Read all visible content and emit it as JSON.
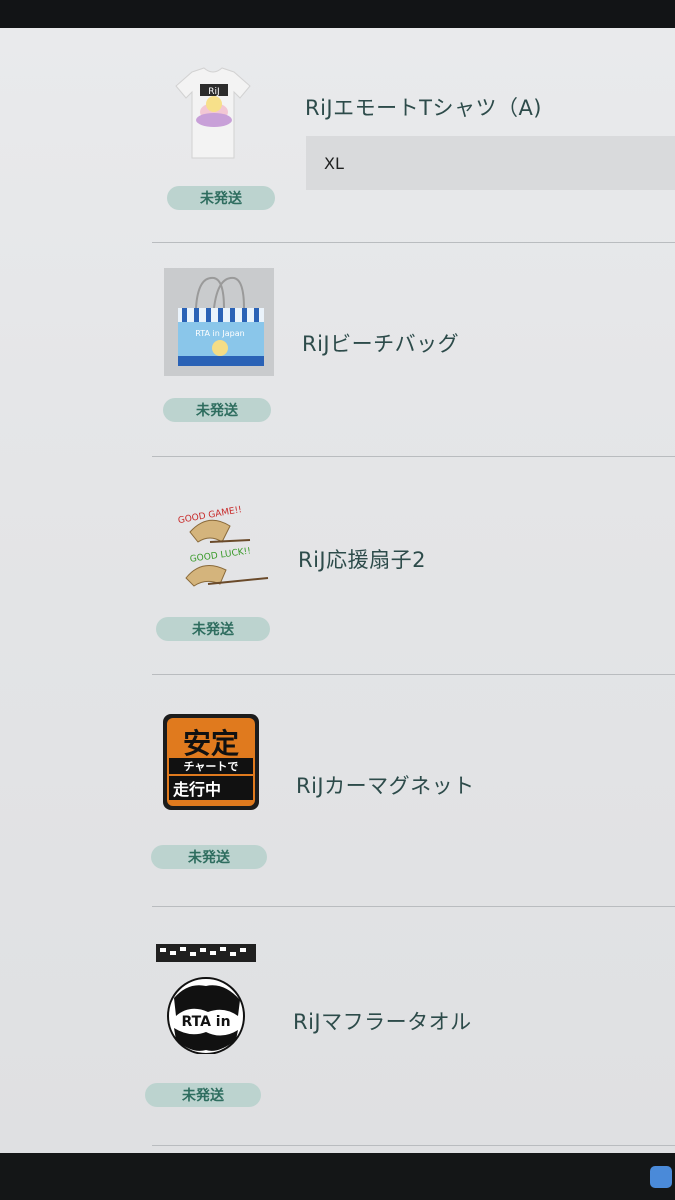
{
  "status_label": "未発送",
  "items": [
    {
      "name": "RiJエモートTシャツ（A)",
      "option": "XL",
      "status": "未発送",
      "thumb_text": "RiJ"
    },
    {
      "name": "RiJビーチバッグ",
      "status": "未発送",
      "thumb_text": "RTA in Japan"
    },
    {
      "name": "RiJ応援扇子2",
      "status": "未発送",
      "thumb_text_1": "GOOD GAME!!",
      "thumb_text_2": "GOOD LUCK!!"
    },
    {
      "name": "RiJカーマグネット",
      "status": "未発送",
      "thumb_line1": "安定",
      "thumb_line2": "チャートで",
      "thumb_line3": "走行中"
    },
    {
      "name": "RiJマフラータオル",
      "status": "未発送",
      "thumb_text": "RTA in"
    }
  ],
  "colors": {
    "badge_bg": "#bcd3cf",
    "badge_text": "#2e6d5f",
    "title_text": "#2d4b4a",
    "page_bg": "#e6e7e9"
  }
}
